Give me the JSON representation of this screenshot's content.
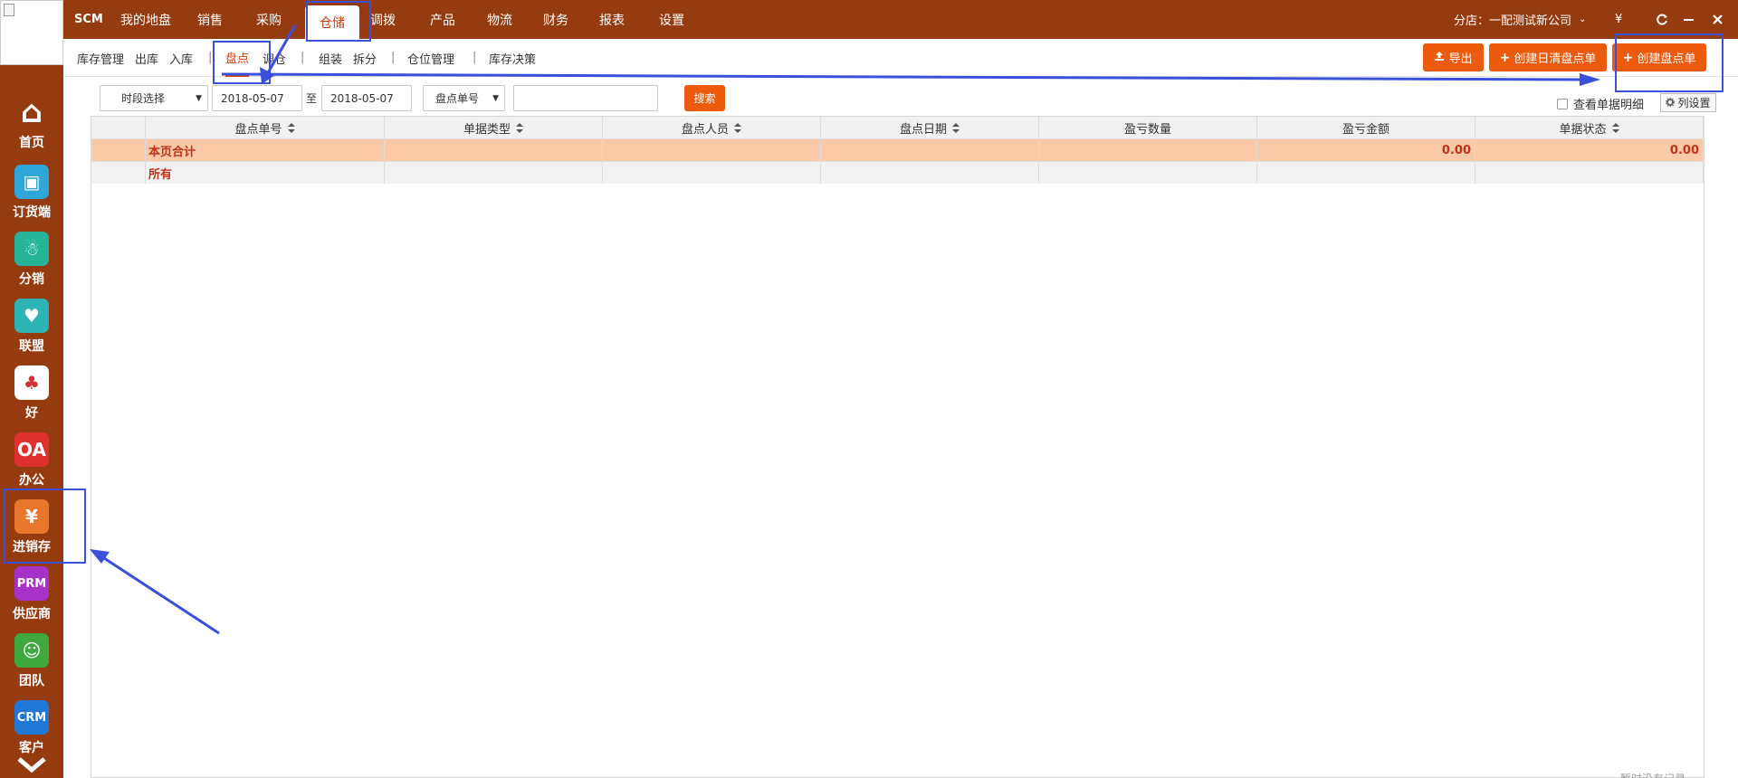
{
  "rail": {
    "items": [
      {
        "label": "首页",
        "icon": "home-icon",
        "color": "#963b10",
        "glyph": "⌂"
      },
      {
        "label": "订货端",
        "icon": "order-icon",
        "color": "#2fa6d8",
        "glyph": "▣"
      },
      {
        "label": "分销",
        "icon": "network-icon",
        "color": "#25b39a",
        "glyph": "☃"
      },
      {
        "label": "联盟",
        "icon": "handshake-icon",
        "color": "#2bb4b3",
        "glyph": "♥"
      },
      {
        "label": "好",
        "icon": "hao-icon",
        "color": "#ffffff",
        "glyph": "♣"
      },
      {
        "label": "办公",
        "icon": "oa-icon",
        "color": "#e0302d",
        "glyph": "OA"
      },
      {
        "label": "进销存",
        "icon": "yen-icon",
        "color": "#e6772c",
        "glyph": "¥"
      },
      {
        "label": "供应商",
        "icon": "prm-icon",
        "color": "#a832c9",
        "glyph": "PRM"
      },
      {
        "label": "团队",
        "icon": "team-icon",
        "color": "#3fa83f",
        "glyph": "☺"
      },
      {
        "label": "客户",
        "icon": "crm-icon",
        "color": "#1f78d6",
        "glyph": "CRM"
      }
    ]
  },
  "topbar": {
    "brand": "SCM",
    "nav": [
      "我的地盘",
      "销售",
      "采购",
      "仓储",
      "调拨",
      "产品",
      "物流",
      "财务",
      "报表",
      "设置"
    ],
    "active_index": 3,
    "shop_label": "分店：一配测试新公司",
    "currency": "¥"
  },
  "subbar": {
    "items": [
      "库存管理",
      "出库",
      "入库",
      "盘点",
      "调仓",
      "组装",
      "拆分",
      "仓位管理",
      "库存决策"
    ],
    "active_index": 3,
    "buttons": {
      "export": "导出",
      "create_daily": "创建日清盘点单",
      "create": "创建盘点单"
    }
  },
  "filters": {
    "period": "时段选择",
    "date_from": "2018-05-07",
    "date_to_sep": "至",
    "date_to": "2018-05-07",
    "field_select": "盘点单号",
    "keyword": "",
    "search_button": "搜索",
    "show_detail": "查看单据明细",
    "column_settings": "列设置"
  },
  "table": {
    "columns": [
      "盘点单号",
      "单据类型",
      "盘点人员",
      "盘点日期",
      "盈亏数量",
      "盈亏金额",
      "单据状态"
    ],
    "sortable": [
      true,
      true,
      true,
      true,
      false,
      false,
      true
    ],
    "rows": [
      {
        "label": "本页合计",
        "values": [
          "",
          "",
          "",
          "",
          "0.00",
          "0.00",
          ""
        ]
      },
      {
        "label": "所有",
        "values": [
          "",
          "",
          "",
          "",
          "",
          "",
          ""
        ]
      }
    ],
    "footer_hint": "暂时没有记录"
  },
  "colors": {
    "brand_bar": "#963b10",
    "accent_orange": "#ec5a0b",
    "annotation_blue": "#3a50d9",
    "summary_row": "#f9c9a8"
  }
}
